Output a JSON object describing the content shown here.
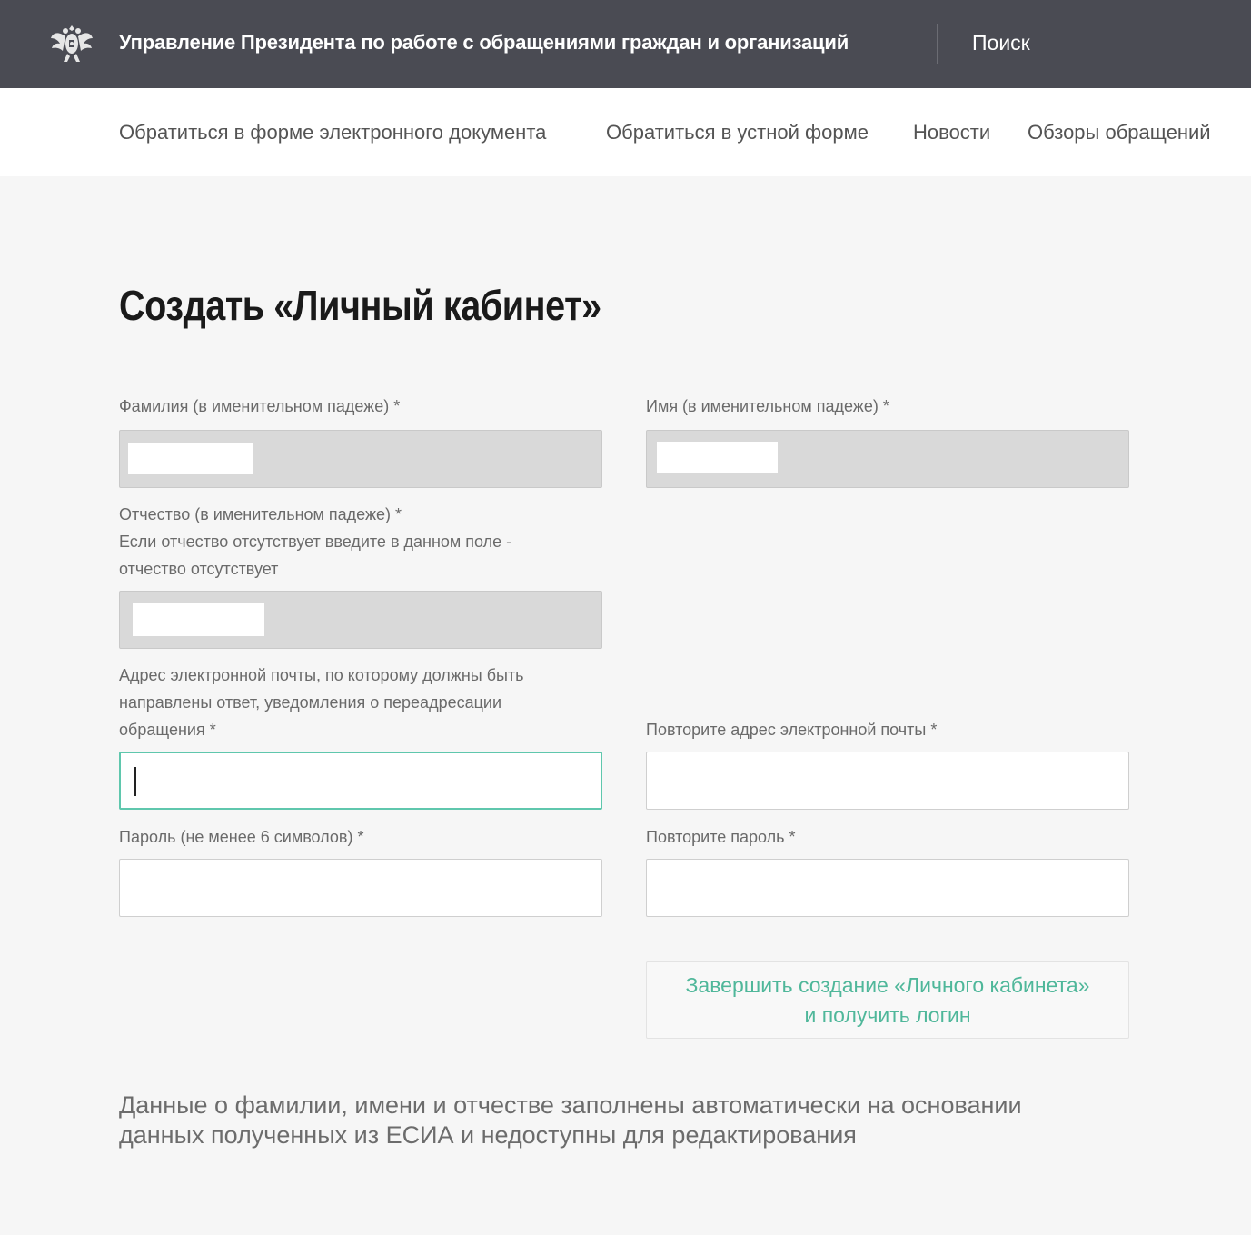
{
  "header": {
    "emblem_icon": "double-headed-eagle-emblem",
    "org_title": "Управление Президента по работе с обращениями граждан и организаций",
    "search_label": "Поиск"
  },
  "nav": {
    "items": [
      "Обратиться в форме электронного документа",
      "Обратиться в устной форме",
      "Новости",
      "Обзоры обращений"
    ]
  },
  "page": {
    "title": "Создать «Личный кабинет»"
  },
  "form": {
    "last_name_label": "Фамилия (в именительном падеже) *",
    "first_name_label": "Имя (в именительном падеже) *",
    "patronymic_label_1": "Отчество (в именительном падеже) *",
    "patronymic_label_2": "Если отчество отсутствует введите в данном поле -",
    "patronymic_label_3": "отчество отсутствует",
    "email_label_1": "Адрес электронной почты, по которому должны быть",
    "email_label_2": "направлены ответ, уведомления о переадресации",
    "email_label_3": "обращения *",
    "email_repeat_label": "Повторите адрес электронной почты *",
    "password_label": "Пароль (не менее 6 символов) *",
    "password_repeat_label": "Повторите пароль *",
    "email_value": "",
    "email_repeat_value": "",
    "password_value": "",
    "password_repeat_value": "",
    "submit_line_1": "Завершить создание «Личного кабинета»",
    "submit_line_2": "и получить логин"
  },
  "note": {
    "line_1": "Данные о фамилии, имени и отчестве заполнены автоматически на основании",
    "line_2": "данных полученных из ЕСИА и недоступны для редактирования"
  },
  "colors": {
    "header_bg": "#4a4b53",
    "accent": "#4fb79a",
    "focus_border": "#5fc7ad",
    "disabled_field": "#d9d9d9"
  }
}
